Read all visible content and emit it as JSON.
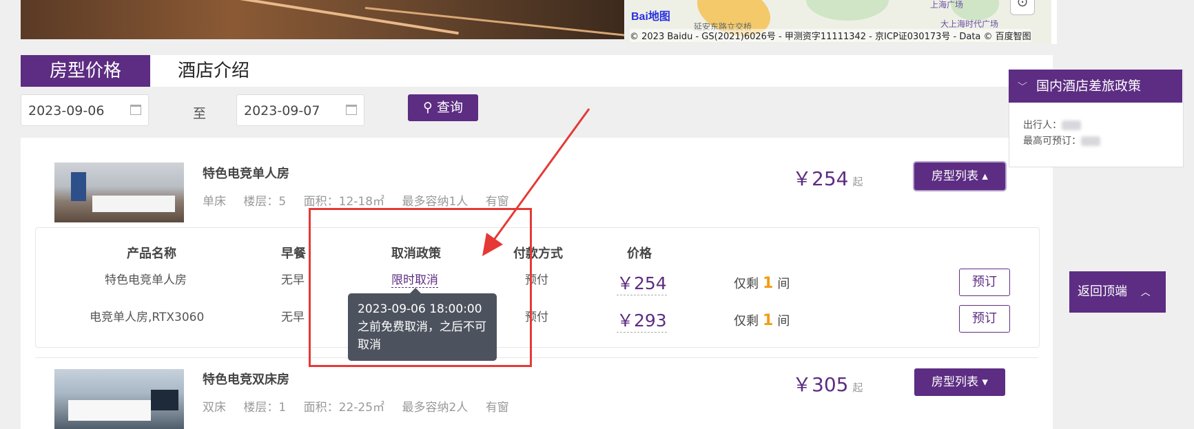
{
  "map": {
    "logo_text": "Bai",
    "logo_suffix": "地图",
    "place1": "延安东路立交桥",
    "place2": "上海广场",
    "place3": "大上海时代广场",
    "copyright": "© 2023 Baidu - GS(2021)6026号 - 甲测资字11111342 - 京ICP证030173号 - Data © 百度智图"
  },
  "tabs": [
    {
      "label": "房型价格",
      "active": true
    },
    {
      "label": "酒店介绍",
      "active": false
    }
  ],
  "search": {
    "checkin": "2023-09-06",
    "to_label": "至",
    "checkout": "2023-09-07",
    "button_label": "查询"
  },
  "rooms": [
    {
      "name": "特色电竞单人房",
      "specs": [
        "单床",
        "楼层：5",
        "面积：12-18㎡",
        "最多容纳1人",
        "有窗"
      ],
      "price": "￥254",
      "price_suffix": "起",
      "list_button": "房型列表 ▴"
    },
    {
      "name": "特色电竞双床房",
      "specs": [
        "双床",
        "楼层：1",
        "面积：22-25㎡",
        "最多容纳2人",
        "有窗"
      ],
      "price": "￥305",
      "price_suffix": "起",
      "list_button": "房型列表 ▾"
    }
  ],
  "product_table": {
    "headers": [
      "产品名称",
      "早餐",
      "取消政策",
      "付款方式",
      "价格"
    ],
    "rows": [
      {
        "product": "特色电竞单人房",
        "breakfast": "无早",
        "cancel": "限时取消",
        "payment": "预付",
        "price": "￥254",
        "remain_prefix": "仅剩",
        "remain_count": "1",
        "remain_suffix": "间",
        "book": "预订"
      },
      {
        "product": "电竞单人房,RTX3060",
        "breakfast": "无早",
        "cancel": "",
        "payment": "预付",
        "price": "￥293",
        "remain_prefix": "仅剩",
        "remain_count": "1",
        "remain_suffix": "间",
        "book": "预订"
      }
    ]
  },
  "tooltip": {
    "text": "2023-09-06 18:00:00之前免费取消，之后不可取消"
  },
  "policy": {
    "title": "国内酒店差旅政策",
    "traveler_label": "出行人：",
    "max_label": "最高可预订："
  },
  "back_to_top": "返回顶端",
  "colors": {
    "brand": "#5c2d82",
    "highlight": "#e53935",
    "remain": "#f39c12",
    "tooltip_bg": "#4d535e"
  }
}
